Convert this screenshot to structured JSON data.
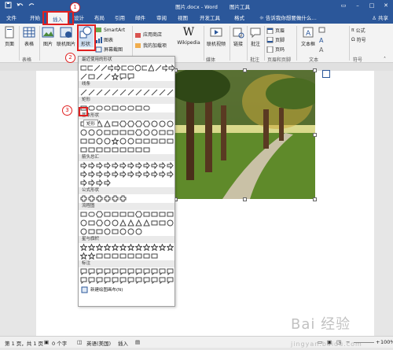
{
  "window": {
    "title": "图片.docx - Word",
    "context_tool_title": "图片工具",
    "share_label": "共享",
    "tell_me_placeholder": "告诉我你想要做什么…"
  },
  "tabs": [
    {
      "label": "文件"
    },
    {
      "label": "开始"
    },
    {
      "label": "插入"
    },
    {
      "label": "设计"
    },
    {
      "label": "布局"
    },
    {
      "label": "引用"
    },
    {
      "label": "邮件"
    },
    {
      "label": "审阅"
    },
    {
      "label": "视图"
    },
    {
      "label": "开发工具"
    },
    {
      "label": "格式"
    }
  ],
  "ribbon": {
    "page_label": "页面",
    "table_label": "表格",
    "picture_label": "图片",
    "online_picture_label": "联机图片",
    "shapes_label": "形状",
    "smartart_label": "SmartArt",
    "chart_label": "图表",
    "screenshot_label": "屏幕截图",
    "store_label": "应用商店",
    "my_addins_label": "我的加载项",
    "wikipedia_label": "Wikipedia",
    "online_video_label": "联机视频",
    "link_label": "链接",
    "comment_label": "批注",
    "header_label": "页眉",
    "footer_label": "页脚",
    "page_number_label": "页码",
    "textbox_label": "文本框",
    "equation_label": "公式",
    "symbol_label": "符号",
    "groups": {
      "tables": "表格",
      "media": "媒体",
      "comments": "批注",
      "header_footer": "页眉和页脚",
      "text": "文本",
      "symbols": "符号"
    }
  },
  "shapes_menu": {
    "recent": "最近使用的形状",
    "lines": "线条",
    "rectangles": "矩形",
    "basic": "基本形状",
    "block_arrows": "箭头总汇",
    "equation_shapes": "公式形状",
    "flowchart": "流程图",
    "stars": "星与旗帜",
    "callouts": "标注",
    "new_canvas": "新建绘图画布(N)",
    "tooltip": "矩形"
  },
  "status": {
    "page": "第 1 页，共 1 页",
    "words": "0 个字",
    "language": "英语(美国)",
    "mode": "插入",
    "zoom": "100%"
  },
  "markers": {
    "one": "1",
    "two": "2",
    "three": "3"
  },
  "watermark": "Bai 经验",
  "watermark_sub": "jingyan.baidu.com",
  "colors": {
    "accent": "#2b579a",
    "highlight": "#e02020"
  }
}
